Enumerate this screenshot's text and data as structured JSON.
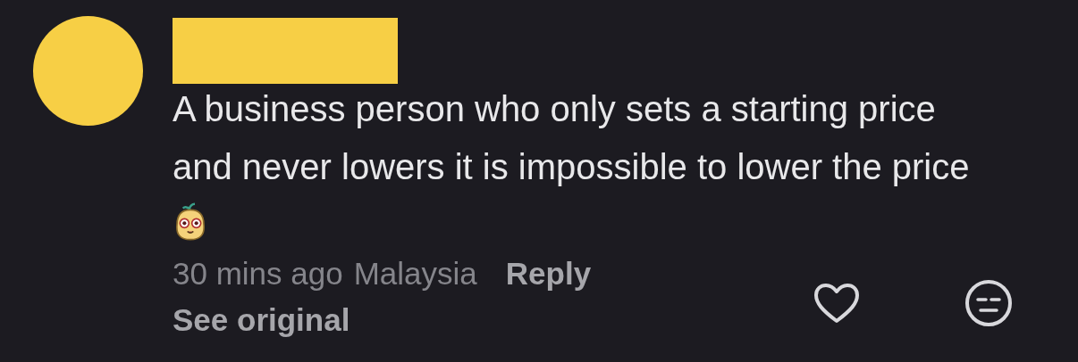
{
  "comment": {
    "text": "A business person who only sets a starting price and never lowers it is impossible to lower the price",
    "sticker": {
      "kind": "sticker"
    },
    "time": "30 mins ago",
    "location": "Malaysia",
    "reply": "Reply",
    "see_original": "See original",
    "liked": false
  }
}
